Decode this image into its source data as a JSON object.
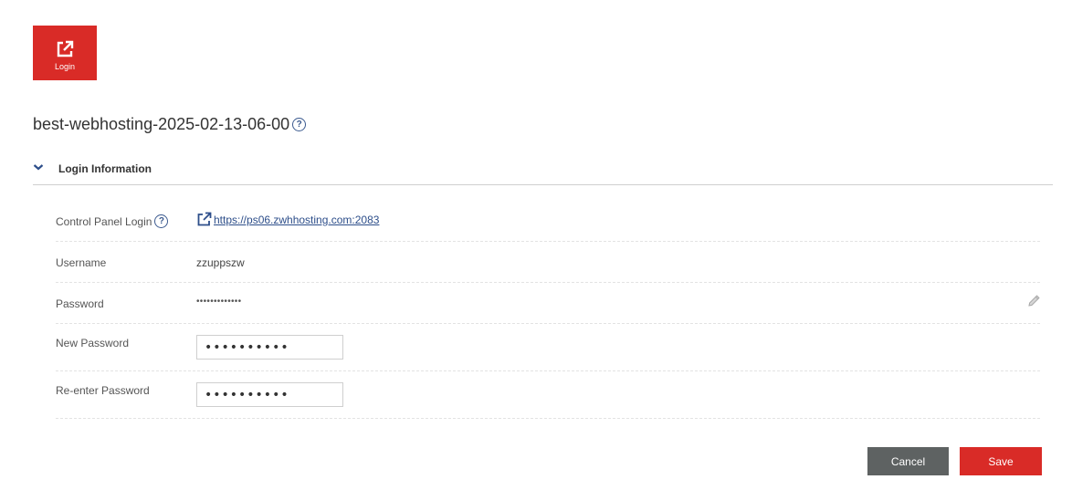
{
  "colors": {
    "accent_red": "#d92b27",
    "cancel_gray": "#5e6262",
    "link_blue": "#2d4e8a"
  },
  "tile": {
    "label": "Login",
    "icon": "external-link-icon"
  },
  "page": {
    "title": "best-webhosting-2025-02-13-06-00",
    "help_icon": "help-icon"
  },
  "section": {
    "title": "Login Information",
    "expanded": true
  },
  "rows": {
    "control_panel": {
      "label": "Control Panel Login",
      "url": "https://ps06.zwhhosting.com:2083"
    },
    "username": {
      "label": "Username",
      "value": "zzuppszw"
    },
    "password": {
      "label": "Password",
      "value": "•••••••••••••"
    },
    "new_password": {
      "label": "New Password",
      "value": "••••••••••"
    },
    "reenter_password": {
      "label": "Re-enter Password",
      "value": "••••••••••"
    }
  },
  "actions": {
    "cancel_label": "Cancel",
    "save_label": "Save"
  }
}
